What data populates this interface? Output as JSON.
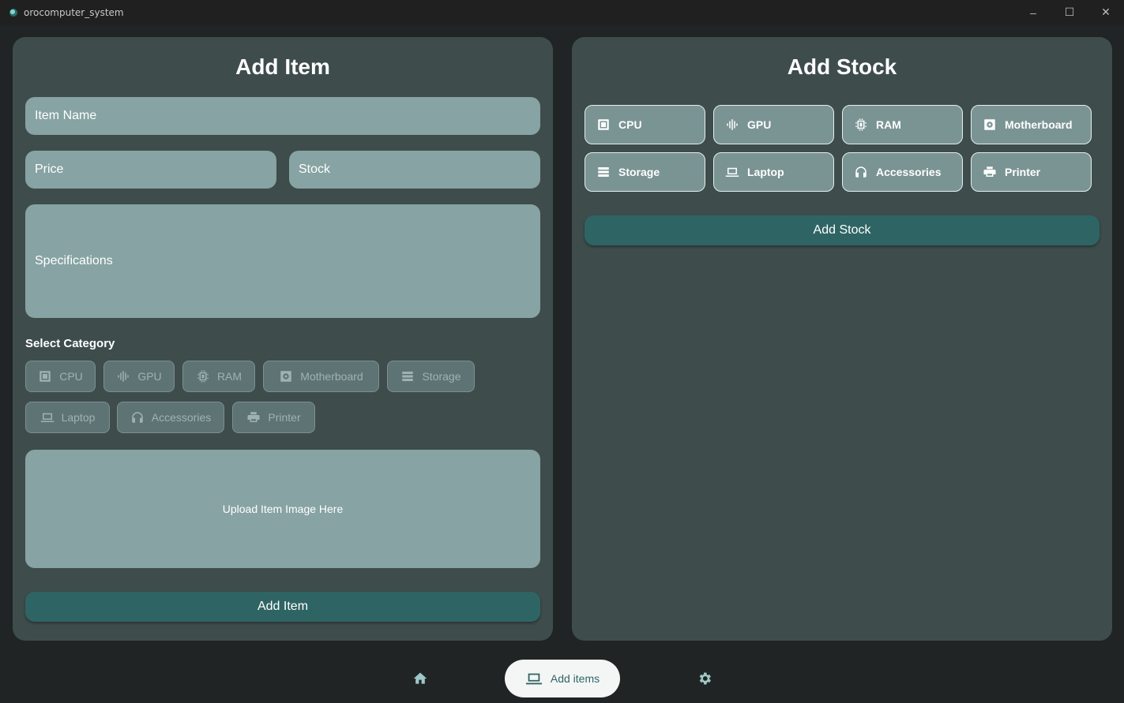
{
  "window": {
    "title": "orocomputer_system",
    "minimize": "–",
    "maximize": "☐",
    "close": "✕"
  },
  "add_item": {
    "title": "Add Item",
    "item_name_placeholder": "Item Name",
    "price_placeholder": "Price",
    "stock_placeholder": "Stock",
    "specifications_placeholder": "Specifications",
    "select_category_label": "Select Category",
    "categories": [
      {
        "label": "CPU",
        "icon": "cpu-icon"
      },
      {
        "label": "GPU",
        "icon": "gpu-icon"
      },
      {
        "label": "RAM",
        "icon": "ram-icon"
      },
      {
        "label": "Motherboard",
        "icon": "motherboard-icon"
      },
      {
        "label": "Storage",
        "icon": "storage-icon"
      },
      {
        "label": "Laptop",
        "icon": "laptop-icon"
      },
      {
        "label": "Accessories",
        "icon": "headphones-icon"
      },
      {
        "label": "Printer",
        "icon": "printer-icon"
      }
    ],
    "upload_label": "Upload Item Image Here",
    "submit_label": "Add Item"
  },
  "add_stock": {
    "title": "Add Stock",
    "categories": [
      {
        "label": "CPU",
        "icon": "cpu-icon"
      },
      {
        "label": "GPU",
        "icon": "gpu-icon"
      },
      {
        "label": "RAM",
        "icon": "ram-icon"
      },
      {
        "label": "Motherboard",
        "icon": "motherboard-icon"
      },
      {
        "label": "Storage",
        "icon": "storage-icon"
      },
      {
        "label": "Laptop",
        "icon": "laptop-icon"
      },
      {
        "label": "Accessories",
        "icon": "headphones-icon"
      },
      {
        "label": "Printer",
        "icon": "printer-icon"
      }
    ],
    "submit_label": "Add Stock"
  },
  "nav": {
    "home_icon": "home-icon",
    "active_label": "Add items",
    "active_icon": "laptop-icon",
    "settings_icon": "gear-icon"
  },
  "colors": {
    "background": "#202424",
    "panel": "#3e4c4c",
    "field": "#87a3a3",
    "accent": "#2f6464"
  }
}
